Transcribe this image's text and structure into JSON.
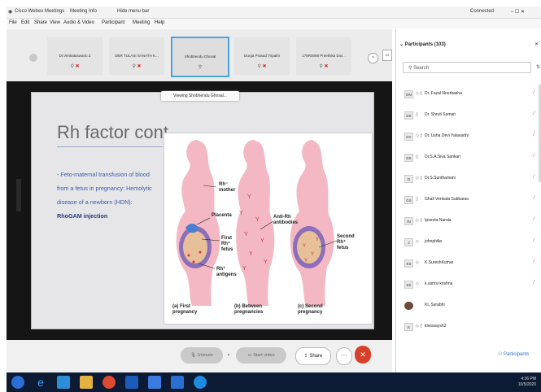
{
  "titlebar": {
    "app_title": "Cisco Webex Meetings",
    "meeting_info": "Meeting Info",
    "hide_menu": "Hide menu bar",
    "status": "Connected",
    "win_controls": "– ☐ ✕"
  },
  "menu": [
    "File",
    "Edit",
    "Share",
    "View",
    "Audio & Video",
    "Participant",
    "Meeting",
    "Help"
  ],
  "thumbnails": [
    {
      "name": "Dr.Venkataswarlu Z",
      "sub": "Me"
    },
    {
      "name": "DBR TULASI SANATH K...",
      "sub": "Host"
    },
    {
      "name": "Shobhendu Ghosal",
      "sub": ""
    },
    {
      "name": "Durga Prasad Tripathi",
      "sub": ""
    },
    {
      "name": "178R0098 Preethika Dixi...",
      "sub": ""
    }
  ],
  "tooltip": "Viewing Shobhendu Ghosal...",
  "slide": {
    "title": "Rh factor cont.",
    "bullet_prefix": "- Feto-maternal transfusion of blood from a fetus in pregnancy: Hemolytic disease of a newborn (HDN): ",
    "bullet_bold": "RhoGAM injection",
    "figure_labels": {
      "rh_mother": "Rh⁻\nmother",
      "placenta": "Placenta",
      "first_fetus": "First\nRh⁺\nfetus",
      "rh_antigens": "Rh⁺\nantigens",
      "anti_rh": "Anti-Rh\nantibodies",
      "second_fetus": "Second\nRh⁺\nfetus",
      "caption_a": "(a) First\npregnancy",
      "caption_b": "(b) Between\npregnancies",
      "caption_c": "(c) Second\npregnancy"
    }
  },
  "controls": {
    "unmute": "Unmute",
    "start_video": "Start video",
    "share": "Share",
    "more": "···",
    "end": "✕"
  },
  "panel": {
    "title": "Participants (103)",
    "search_placeholder": "Search",
    "participants_button": "Participants",
    "rows": [
      {
        "initials": "DN",
        "name": "Dr. Fazal Noorbasha"
      },
      {
        "initials": "DS",
        "name": "Dr. Shruti Suman"
      },
      {
        "initials": "DY",
        "name": "Dr. Usha Devi Yalavarthi"
      },
      {
        "initials": "DS",
        "name": "Dr.S.A.Siva Sankari"
      },
      {
        "initials": "D",
        "name": "Dr.S.Sunthamani"
      },
      {
        "initials": "GS",
        "name": "Ghali Venkata Subbarao"
      },
      {
        "initials": "IN",
        "name": "Ipseeta Nanda"
      },
      {
        "initials": "J",
        "name": "johnphilip"
      },
      {
        "initials": "KS",
        "name": "K.SureshKumar"
      },
      {
        "initials": "KK",
        "name": "k.vamsi krishna"
      },
      {
        "initials": "",
        "name": "KL Surabhi"
      },
      {
        "initials": "K",
        "name": "knessaysh2"
      }
    ]
  },
  "tray": {
    "time": "4:36 PM",
    "date": "10/5/2020"
  },
  "colors": {
    "accent": "#4aa3df",
    "end_red": "#d8402a",
    "slide_text": "#3c5aa8",
    "taskbar": "#0c1a33"
  }
}
